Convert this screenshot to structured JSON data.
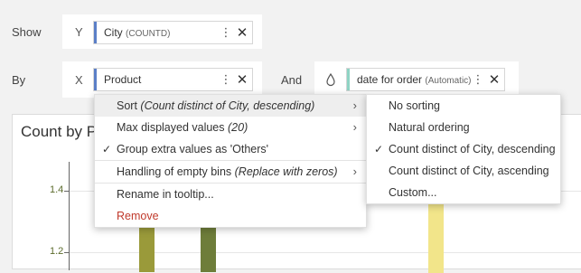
{
  "shelves": {
    "show_label": "Show",
    "by_label": "By",
    "and_label": "And",
    "y_axis_letter": "Y",
    "x_axis_letter": "X",
    "y_pill": {
      "name": "City",
      "agg": "(COUNTD)"
    },
    "x_pill": {
      "name": "Product"
    },
    "color_pill": {
      "name": "date for order",
      "agg": "(Automatic)"
    }
  },
  "chart": {
    "title": "Count by P",
    "y_ticks": [
      "1.4",
      "1.2"
    ]
  },
  "context_menu": {
    "sort": {
      "label": "Sort",
      "detail": "(Count distinct of City, descending)"
    },
    "max_displayed": {
      "label": "Max displayed values",
      "detail": "(20)"
    },
    "group_extra": {
      "label": "Group extra values as 'Others'"
    },
    "empty_bins": {
      "label": "Handling of empty bins",
      "detail": "(Replace with zeros)"
    },
    "rename": {
      "label": "Rename in tooltip..."
    },
    "remove": {
      "label": "Remove"
    }
  },
  "sort_submenu": {
    "no_sorting": "No sorting",
    "natural": "Natural ordering",
    "desc": "Count distinct of City, descending",
    "asc": "Count distinct of City, ascending",
    "custom": "Custom..."
  },
  "colors": {
    "y_stripe": "#5b7fc7",
    "x_stripe": "#5b7fc7",
    "color_stripe": "#8fd4c4",
    "bar_olive": "#9a9a3a",
    "bar_green": "#6e7d3a",
    "bar_yellow": "#f2e58a",
    "remove_red": "#c0392b"
  },
  "icons": {
    "kebab": "⋮",
    "close": "✕",
    "chevron": "›",
    "check": "✓",
    "droplet": "droplet-icon"
  }
}
